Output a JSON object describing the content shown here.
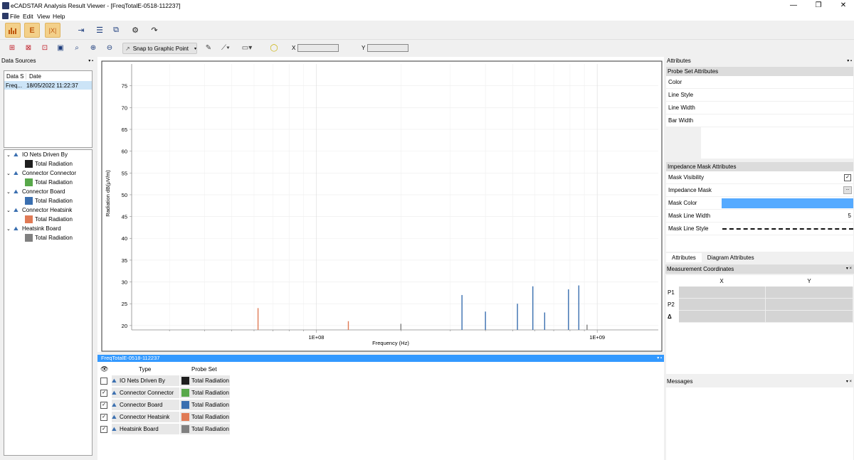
{
  "window": {
    "title": "eCADSTAR Analysis Result Viewer - [FreqTotalE-0518-112237]",
    "minimize": "—",
    "restore": "❐",
    "close": "✕"
  },
  "menu": [
    "File",
    "Edit",
    "View",
    "Help"
  ],
  "toolbar2": {
    "snap_label": "Snap to Graphic Point",
    "x_label": "X",
    "y_label": "Y"
  },
  "data_sources": {
    "title": "Data Sources",
    "col_data": "Data S",
    "col_date": "Date",
    "row_data": "Freq...",
    "row_date": "18/05/2022 11:22:37"
  },
  "tree": [
    {
      "group": "IO Nets Driven By",
      "probe": "Total Radiation",
      "color": "#1e1e1e"
    },
    {
      "group": "Connector Connector",
      "probe": "Total Radiation",
      "color": "#58a84a"
    },
    {
      "group": "Connector Board",
      "probe": "Total Radiation",
      "color": "#3a6fb0"
    },
    {
      "group": "Connector Heatsink",
      "probe": "Total Radiation",
      "color": "#e07a55"
    },
    {
      "group": "Heatsink Board",
      "probe": "Total Radiation",
      "color": "#808080"
    }
  ],
  "chart_data": {
    "type": "bar",
    "xlabel": "Frequency (Hz)",
    "ylabel": "Radiation dB(μV/m)",
    "x_scale": "log",
    "x_tick_labels": [
      "1E+08",
      "1E+09"
    ],
    "ylim": [
      19,
      80
    ],
    "y_ticks": [
      20,
      25,
      30,
      35,
      40,
      45,
      50,
      55,
      60,
      65,
      70,
      75
    ],
    "grid": true,
    "series": [
      {
        "name": "Connector Heatsink",
        "color": "#e07a55",
        "x": [
          62000000,
          130000000
        ],
        "values": [
          24,
          21
        ]
      },
      {
        "name": "Connector Board",
        "color": "#3a6fb0",
        "x": [
          330000000,
          400000000,
          520000000,
          590000000,
          650000000,
          790000000,
          860000000
        ],
        "values": [
          27,
          23.2,
          25,
          29,
          23,
          28.3,
          29.2
        ]
      },
      {
        "name": "Heatsink Board",
        "color": "#808080",
        "x": [
          200000000,
          920000000
        ],
        "values": [
          20.4,
          20.2
        ]
      }
    ]
  },
  "results_tab": {
    "title": "FreqTotalE-0518-112237",
    "col_type": "Type",
    "col_probe": "Probe Set",
    "rows": [
      {
        "type": "IO Nets Driven By",
        "probe": "Total Radiation",
        "checked": false,
        "color": "#1e1e1e"
      },
      {
        "type": "Connector Connector",
        "probe": "Total Radiation",
        "checked": true,
        "color": "#58a84a"
      },
      {
        "type": "Connector Board",
        "probe": "Total Radiation",
        "checked": true,
        "color": "#3a6fb0"
      },
      {
        "type": "Connector Heatsink",
        "probe": "Total Radiation",
        "checked": true,
        "color": "#e07a55"
      },
      {
        "type": "Heatsink Board",
        "probe": "Total Radiation",
        "checked": true,
        "color": "#808080"
      }
    ]
  },
  "attributes": {
    "title": "Attributes",
    "probe_set_title": "Probe Set Attributes",
    "probe_rows": [
      "Color",
      "Line Style",
      "Line Width",
      "Bar Width"
    ],
    "mask_title": "Impedance Mask Attributes",
    "mask_rows": [
      "Mask Visibility",
      "Impedance Mask",
      "Mask Color",
      "Mask Line Width",
      "Mask Line Style"
    ],
    "mask_visibility_check": "✓",
    "impedance_mask_btn": "...",
    "mask_color": "#55aaff",
    "mask_line_width": "5",
    "tabs": [
      "Attributes",
      "Diagram Attributes"
    ]
  },
  "measurement": {
    "title": "Measurement Coordinates",
    "col_x": "X",
    "col_y": "Y",
    "rows": [
      "P1",
      "P2",
      "Δ"
    ]
  },
  "messages": {
    "title": "Messages"
  },
  "icons": [
    "app-icon",
    "chart-view-icon",
    "editor-icon",
    "table-view-icon",
    "import-icon",
    "export-icon",
    "settings-icon",
    "zoom-icon"
  ]
}
